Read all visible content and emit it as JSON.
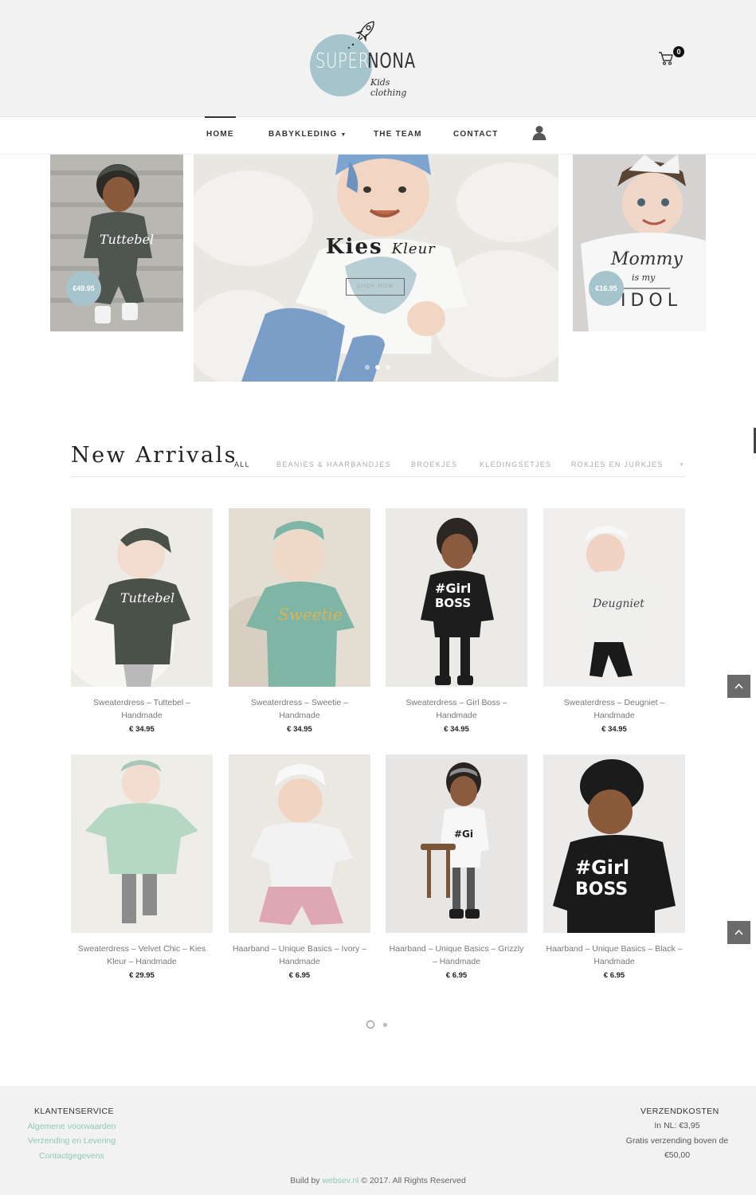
{
  "brand": {
    "name_part1": "Super",
    "name_part2": "Nona",
    "tagline": "Kids clothing",
    "accent_color": "#a6c4cc",
    "link_color": "#8fc9b8"
  },
  "cart": {
    "icon": "cart-icon",
    "count": "0"
  },
  "nav": {
    "items": [
      {
        "label": "HOME",
        "active": true
      },
      {
        "label": "BABYKLEDING",
        "has_dropdown": true
      },
      {
        "label": "THE TEAM"
      },
      {
        "label": "CONTACT"
      }
    ],
    "user_icon": "user-icon"
  },
  "slider": {
    "left_price": "€49.95",
    "right_price": "€16.95",
    "heading_bold": "Kies",
    "heading_italic": "Kleur",
    "button": "SHOP NOW"
  },
  "new_arrivals": {
    "title": "New Arrivals",
    "filters": [
      "ALL",
      "BEANIES & HAARBANDJES",
      "BROEKJES",
      "KLEDINGSETJES",
      "ROKJES EN JURKJES",
      "+"
    ],
    "products": [
      {
        "name": "Sweaterdress – Tuttebel – Handmade",
        "price": "€ 34.95"
      },
      {
        "name": "Sweaterdress – Sweetie – Handmade",
        "price": "€ 34.95"
      },
      {
        "name": "Sweaterdress – Girl Boss – Handmade",
        "price": "€ 34.95"
      },
      {
        "name": "Sweaterdress – Deugniet – Handmade",
        "price": "€ 34.95"
      },
      {
        "name": "Sweaterdress – Velvet Chic – Kies Kleur – Handmade",
        "price": "€ 29.95"
      },
      {
        "name": "Haarband – Unique Basics – Ivory – Handmade",
        "price": "€ 6.95"
      },
      {
        "name": "Haarband – Unique Basics – Grizzly – Handmade",
        "price": "€ 6.95"
      },
      {
        "name": "Haarband – Unique Basics – Black – Handmade",
        "price": "€ 6.95"
      }
    ]
  },
  "footer": {
    "service_title": "KLANTENSERVICE",
    "service_links": [
      "Algemene voorwaarden",
      "Verzending en Levering",
      "Contactgegevens"
    ],
    "shipping_title": "VERZENDKOSTEN",
    "shipping_nl": "In NL: €3,95",
    "shipping_free": "Gratis verzending boven de €50,00",
    "copyright_prefix": "Build by",
    "copyright_link": "websev.nl",
    "copyright_suffix": "© 2017. All Rights Reserved"
  }
}
